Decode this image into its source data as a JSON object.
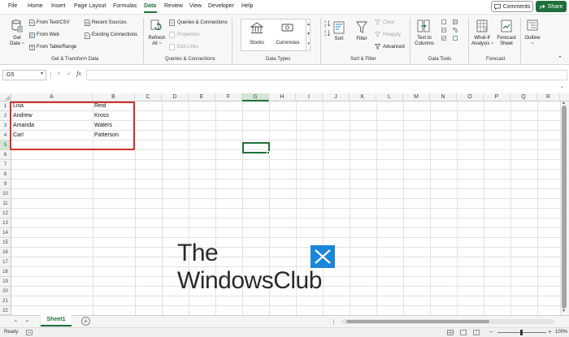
{
  "menu": {
    "items": [
      "File",
      "Home",
      "Insert",
      "Page Layout",
      "Formulas",
      "Data",
      "Review",
      "View",
      "Developer",
      "Help"
    ],
    "active": "Data",
    "comments_label": "Comments",
    "share_label": "Share"
  },
  "ribbon": {
    "get_data": [
      "Get",
      "Data ~"
    ],
    "from_text_csv": "From Text/CSV",
    "from_web": "From Web",
    "from_table_range": "From Table/Range",
    "recent_sources": "Recent Sources",
    "existing_connections": "Existing Connections",
    "group_get_transform": "Get & Transform Data",
    "refresh_all": [
      "Refresh",
      "All ~"
    ],
    "queries_connections": "Queries & Connections",
    "properties": "Properties",
    "edit_links": "Edit Links",
    "group_queries": "Queries & Connections",
    "stocks": "Stocks",
    "currencies": "Currencies",
    "group_data_types": "Data Types",
    "sort": "Sort",
    "filter": "Filter",
    "clear": "Clear",
    "reapply": "Reapply",
    "advanced": "Advanced",
    "group_sort_filter": "Sort & Filter",
    "text_to_columns": [
      "Text to",
      "Columns"
    ],
    "group_data_tools": "Data Tools",
    "what_if": [
      "What-If",
      "Analysis ~"
    ],
    "forecast_sheet": [
      "Forecast",
      "Sheet"
    ],
    "outline": [
      "Outline",
      "~"
    ],
    "group_forecast": "Forecast"
  },
  "formula_bar": {
    "name_box": "G5",
    "cancel_icon": "×",
    "enter_icon": "✓",
    "fx": "fx",
    "value": ""
  },
  "grid": {
    "columns": [
      "A",
      "B",
      "C",
      "D",
      "E",
      "F",
      "G",
      "H",
      "I",
      "J",
      "K",
      "L",
      "M",
      "N",
      "O",
      "P",
      "Q",
      "R"
    ],
    "selected_column": "G",
    "rows": [
      "1",
      "2",
      "3",
      "4",
      "5",
      "6",
      "7",
      "8",
      "9",
      "10",
      "11",
      "12",
      "13",
      "14",
      "15",
      "16",
      "17",
      "18",
      "19",
      "20",
      "21",
      "22"
    ],
    "selected_row": "5",
    "cells": [
      {
        "a": "Lisa",
        "b": "Reid"
      },
      {
        "a": "Andrew",
        "b": "Kross"
      },
      {
        "a": "Amanda",
        "b": "Waters"
      },
      {
        "a": "Carl",
        "b": "Patterson"
      }
    ]
  },
  "watermark": {
    "line1": "The",
    "line2": "WindowsClub"
  },
  "sheets": {
    "tabs": [
      "Sheet1"
    ],
    "add_label": "+"
  },
  "status": {
    "ready": "Ready",
    "zoom": "100%"
  },
  "colors": {
    "accent": "#1e6f3b",
    "highlight_border": "#d0312d",
    "watermark_blue": "#1a86d8"
  }
}
